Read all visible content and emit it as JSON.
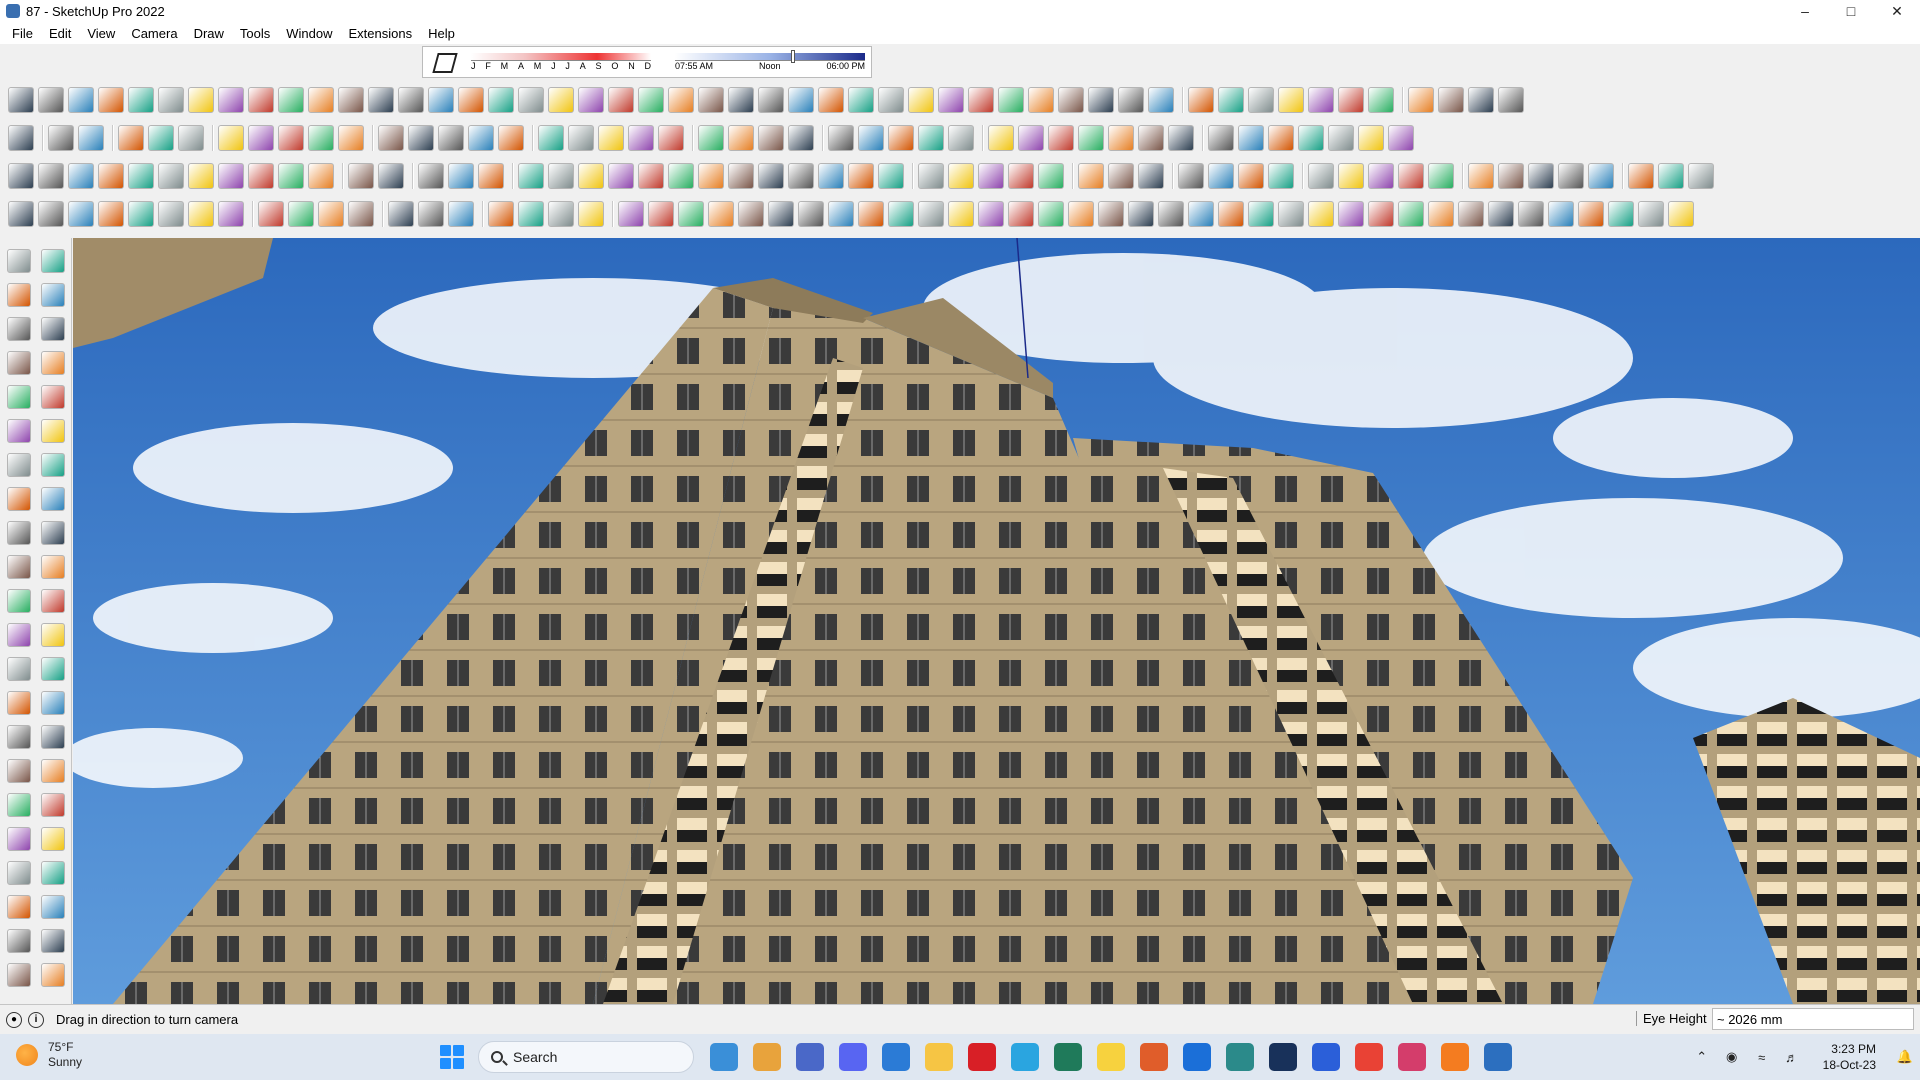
{
  "window": {
    "title": "87 - SketchUp Pro 2022",
    "controls": [
      "minimize",
      "maximize",
      "close"
    ]
  },
  "menu": [
    "File",
    "Edit",
    "View",
    "Camera",
    "Draw",
    "Tools",
    "Window",
    "Extensions",
    "Help"
  ],
  "shadow_settings": {
    "months": [
      "J",
      "F",
      "M",
      "A",
      "M",
      "J",
      "J",
      "A",
      "S",
      "O",
      "N",
      "D"
    ],
    "time_start": "07:55 AM",
    "time_mid": "Noon",
    "time_end": "06:00 PM"
  },
  "status": {
    "hint": "Drag in direction to turn camera",
    "vcb_label": "Eye Height",
    "vcb_value": "~ 2026 mm"
  },
  "taskbar": {
    "weather_temp": "75°F",
    "weather_cond": "Sunny",
    "search_placeholder": "Search",
    "time": "3:23 PM",
    "date": "18-Oct-23"
  },
  "colors": {
    "sky": "#3f82cf",
    "facade": "#b8a37f",
    "window": "#3b3b3b",
    "balcony": "#f3e2c0"
  }
}
